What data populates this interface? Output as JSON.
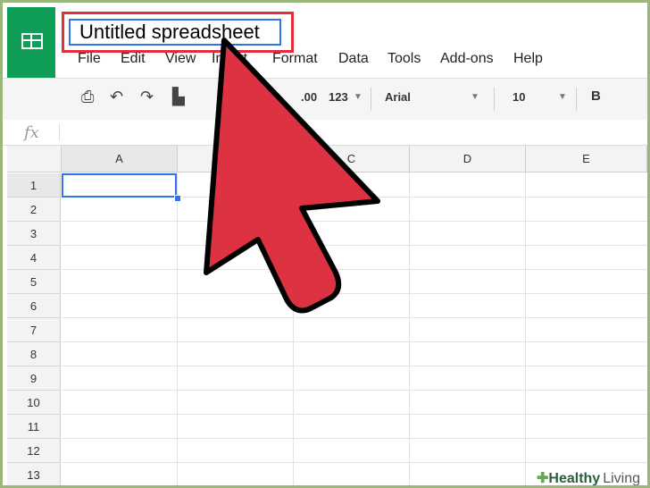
{
  "title_input": {
    "value": "Untitled spreadsheet"
  },
  "menu": [
    "File",
    "Edit",
    "View",
    "Insert",
    "Format",
    "Data",
    "Tools",
    "Add-ons",
    "Help"
  ],
  "toolbar": {
    "decimal_decrease": ".0",
    "decimal_increase": ".00",
    "number_format": "123",
    "font_family": "Arial",
    "font_size": "10",
    "bold": "B"
  },
  "formula_bar": {
    "fx_label": "fx"
  },
  "columns": [
    "A",
    "B",
    "C",
    "D",
    "E"
  ],
  "rows": [
    "1",
    "2",
    "3",
    "4",
    "5",
    "6",
    "7",
    "8",
    "9",
    "10",
    "11",
    "12",
    "13"
  ],
  "watermark": {
    "prefix": "Healthy",
    "suffix": "Living"
  },
  "colors": {
    "accent": "#0f9d58",
    "highlight": "#e02e3c",
    "selection": "#2f73e8",
    "arrow": "#dd3242"
  }
}
